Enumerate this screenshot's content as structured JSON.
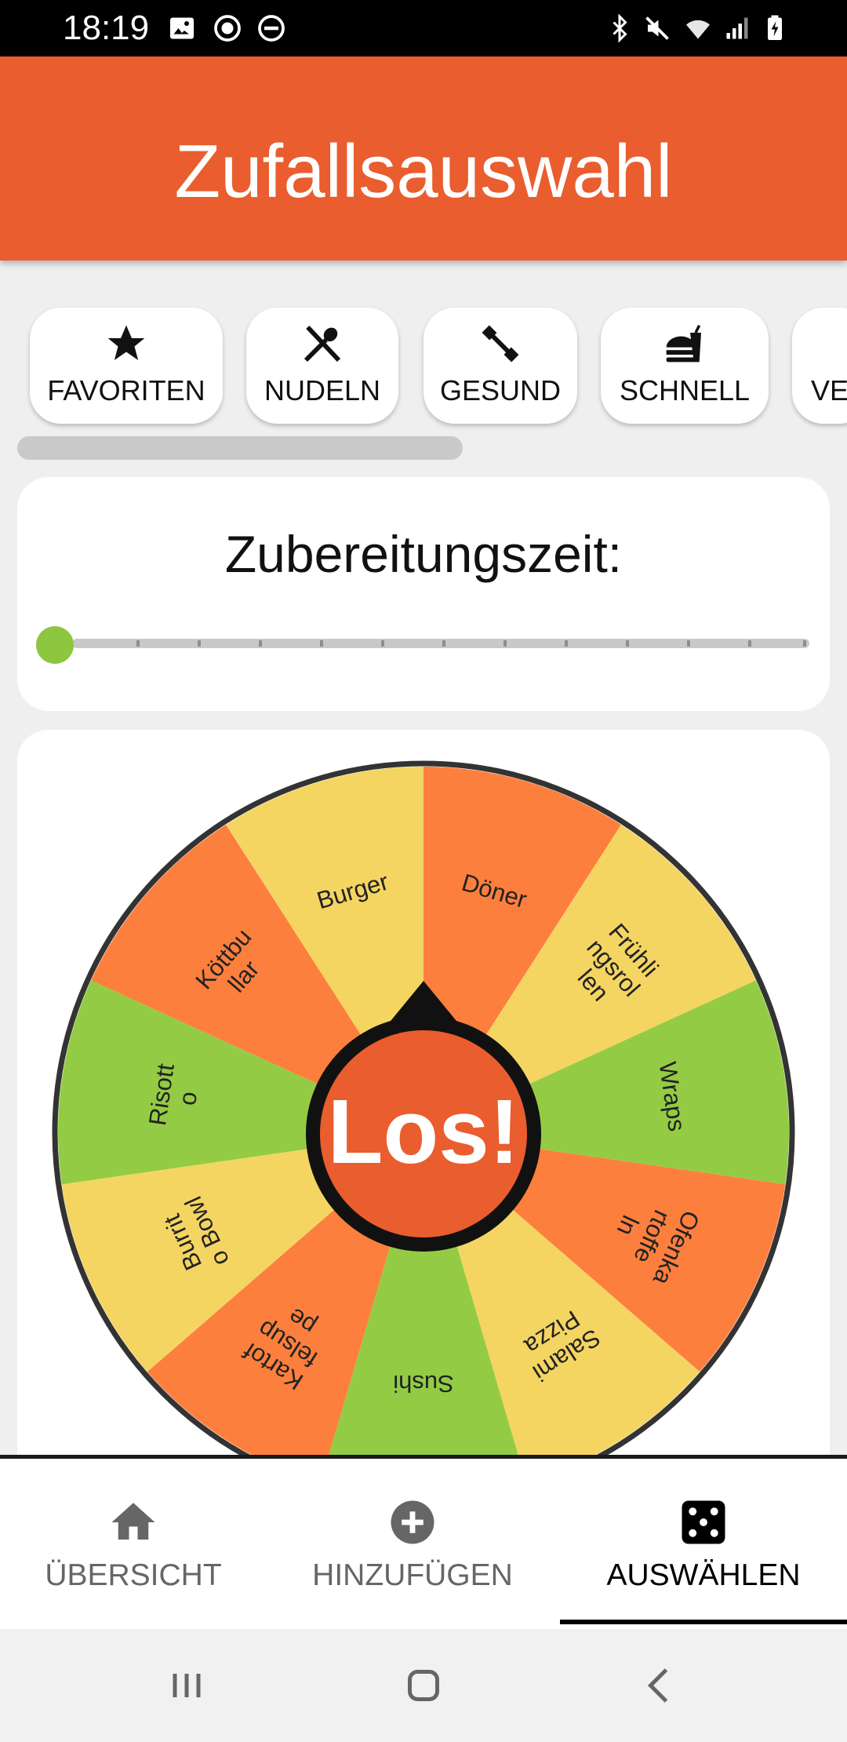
{
  "status_bar": {
    "time": "18:19"
  },
  "app_bar": {
    "title": "Zufallsauswahl"
  },
  "categories": [
    {
      "label": "FAVORITEN",
      "icon": "star-icon"
    },
    {
      "label": "NUDELN",
      "icon": "fork-spoon-icon"
    },
    {
      "label": "GESUND",
      "icon": "dumbbell-icon"
    },
    {
      "label": "SCHNELL",
      "icon": "fastfood-icon"
    },
    {
      "label": "VE",
      "icon": ""
    }
  ],
  "time_filter": {
    "title": "Zubereitungszeit:",
    "value_fraction": 0
  },
  "wheel": {
    "button_label": "Los!",
    "segments": [
      {
        "label": "Döner",
        "color": "#fd7f3d"
      },
      {
        "label": "Frühlingsrollen",
        "color": "#f4d562"
      },
      {
        "label": "Wraps",
        "color": "#93cc44"
      },
      {
        "label": "Ofenkartoffeln",
        "color": "#fd7f3d"
      },
      {
        "label": "Salami Pizza",
        "color": "#f4d562"
      },
      {
        "label": "Sushi",
        "color": "#93cc44"
      },
      {
        "label": "Kartoffelsuppe",
        "color": "#fd7f3d"
      },
      {
        "label": "Burrito Bowl",
        "color": "#f4d562"
      },
      {
        "label": "Risotto",
        "color": "#93cc44"
      },
      {
        "label": "Köttbullar",
        "color": "#fd7f3d"
      },
      {
        "label": "Burger",
        "color": "#f4d562"
      }
    ],
    "segment_lines": [
      [
        "Döner"
      ],
      [
        "Frühli",
        "ngsrol",
        "len"
      ],
      [
        "Wraps"
      ],
      [
        "Ofenka",
        "rtoffe",
        "ln"
      ],
      [
        "Salami",
        "Pizza"
      ],
      [
        "Sushi"
      ],
      [
        "Kartof",
        "felsup",
        "pe"
      ],
      [
        "Burrit",
        "o Bowl"
      ],
      [
        "Risott",
        "o"
      ],
      [
        "Köttbu",
        "llar"
      ],
      [
        "Burger"
      ]
    ]
  },
  "bottom_nav": [
    {
      "label": "ÜBERSICHT",
      "icon": "home-icon",
      "active": false
    },
    {
      "label": "HINZUFÜGEN",
      "icon": "add-circle-icon",
      "active": false
    },
    {
      "label": "AUSWÄHLEN",
      "icon": "dice-icon",
      "active": true
    }
  ],
  "colors": {
    "accent": "#e95d2e",
    "slider_thumb": "#8dc63f",
    "wheel_orange": "#fd7f3d",
    "wheel_yellow": "#f4d562",
    "wheel_green": "#93cc44"
  }
}
